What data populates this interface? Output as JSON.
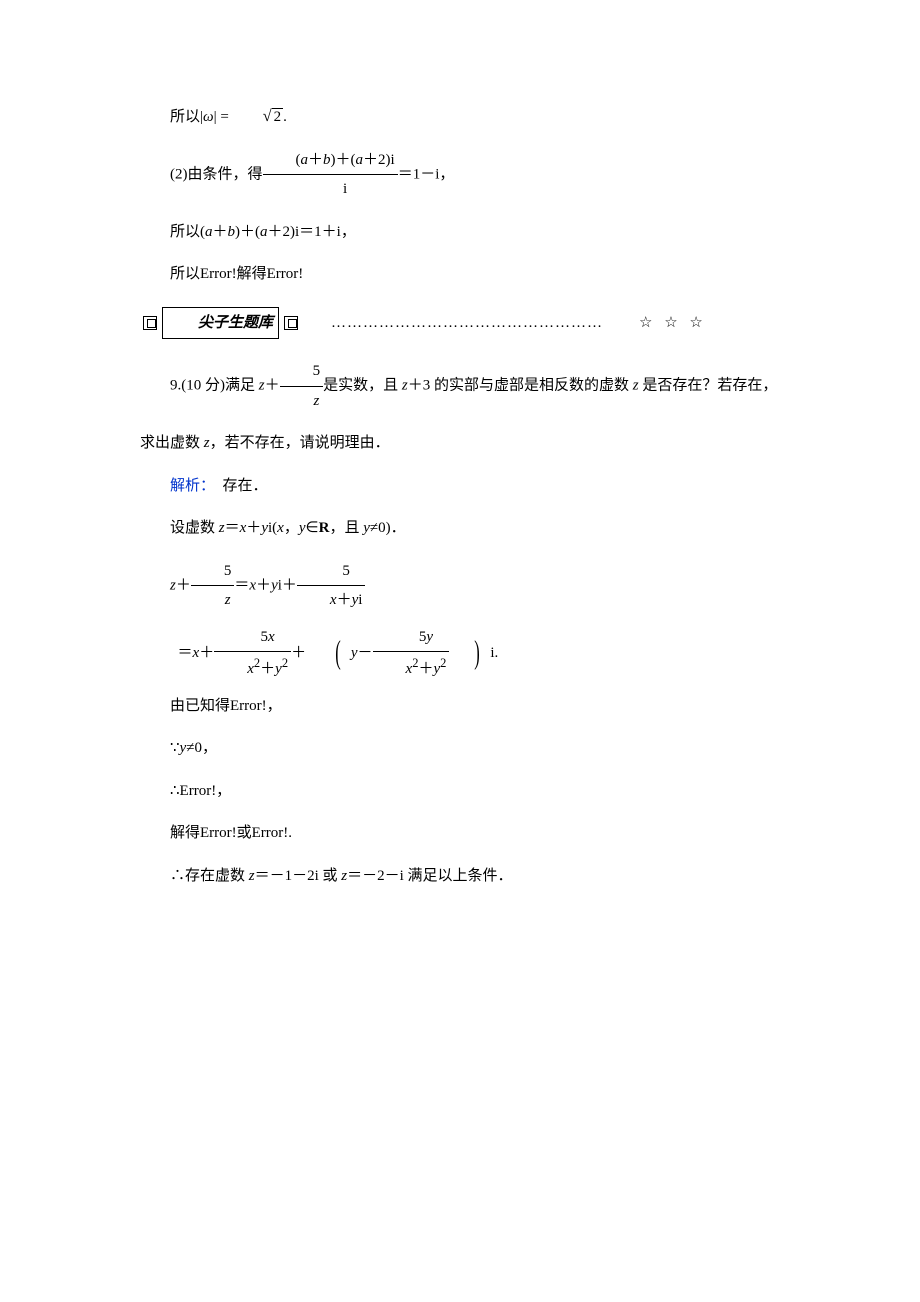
{
  "line1_pre": "所以|",
  "line1_omega": "ω",
  "line1_post": "| =",
  "line1_radicand": "2",
  "line1_end": ".",
  "line2_pre": "(2)由条件，得",
  "line2_num_a": "(",
  "line2_num_a_it": "a",
  "line2_num_b": "＋",
  "line2_num_b_it": "b",
  "line2_num_c": ")＋(",
  "line2_num_c_it": "a",
  "line2_num_d": "＋2)i",
  "line2_den": "i",
  "line2_post": "＝1－i，",
  "line3_pre": "所以(",
  "line3_a": "a",
  "line3_plus1": "＋",
  "line3_b": "b",
  "line3_mid": ")＋(",
  "line3_a2": "a",
  "line3_post": "＋2)i＝1＋i，",
  "line4": "所以Error!解得Error!",
  "section_label": "尖子生题库",
  "section_dots": "……………………………………………",
  "section_stars": "☆ ☆ ☆",
  "q9_pre": "9.(10 分)满足 ",
  "q9_z1": "z",
  "q9_plus": "＋",
  "q9_num": "5",
  "q9_den": "z",
  "q9_mid": "是实数，且 ",
  "q9_z2": "z",
  "q9_post": "＋3 的实部与虚部是相反数的虚数 ",
  "q9_z3": "z",
  "q9_end": " 是否存在？若存在，",
  "q9_line2": "求出虚数 ",
  "q9_line2_z": "z",
  "q9_line2_end": "，若不存在，请说明理由．",
  "ans_label": "解析：",
  "ans_exists": "存在．",
  "step1_pre": "设虚数 ",
  "step1_z": "z",
  "step1_eq": "＝",
  "step1_x": "x",
  "step1_plus": "＋",
  "step1_y": "y",
  "step1_i": "i(",
  "step1_x2": "x",
  "step1_comma": "，",
  "step1_y2": "y",
  "step1_in": "∈",
  "step1_R": "R",
  "step1_and": "，且 ",
  "step1_y3": "y",
  "step1_ne": "≠0)．",
  "eq1_z": "z",
  "eq1_plus": "＋",
  "eq1_frac1_num": "5",
  "eq1_frac1_den": "z",
  "eq1_eq": "＝",
  "eq1_x": "x",
  "eq1_plus2": "＋",
  "eq1_y": "y",
  "eq1_i": "i＋",
  "eq1_frac2_num": "5",
  "eq1_frac2_den_x": "x",
  "eq1_frac2_den_plus": "＋",
  "eq1_frac2_den_y": "y",
  "eq1_frac2_den_i": "i",
  "eq2_eq": "＝",
  "eq2_x": "x",
  "eq2_plus": "＋",
  "eq2_frac1_num": "5",
  "eq2_frac1_num_x": "x",
  "eq2_frac1_den_x": "x",
  "eq2_frac1_den_sq": "2",
  "eq2_frac1_den_plus": "＋",
  "eq2_frac1_den_y": "y",
  "eq2_plus2": "＋",
  "eq2_y": "y",
  "eq2_minus": "－",
  "eq2_frac2_num": "5",
  "eq2_frac2_num_y": "y",
  "eq2_frac2_den_x": "x",
  "eq2_frac2_den_plus": "＋",
  "eq2_frac2_den_y": "y",
  "eq2_i": "i.",
  "step2": "由已知得Error!，",
  "step3_pre": "∵",
  "step3_y": "y",
  "step3_post": "≠0，",
  "step4": "∴Error!，",
  "step5": "解得Error!或Error!.",
  "step6_pre": "∴存在虚数 ",
  "step6_z1": "z",
  "step6_eq1": "＝－1－2i 或 ",
  "step6_z2": "z",
  "step6_eq2": "＝－2－i 满足以上条件．"
}
